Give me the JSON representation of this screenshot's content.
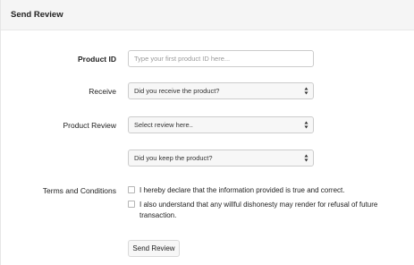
{
  "panel": {
    "title": "Send Review"
  },
  "form": {
    "product_id": {
      "label": "Product ID",
      "placeholder": "Type your first product ID here..."
    },
    "receive": {
      "label": "Receive",
      "selected": "Did you receive the product?"
    },
    "product_review": {
      "label": "Product Review",
      "selected": "Select review here.."
    },
    "keep": {
      "selected": "Did you keep the product?"
    },
    "terms": {
      "label": "Terms and Conditions",
      "checkbox_1": "I hereby declare that the information provided is true and correct.",
      "checkbox_2": "I also understand that any willful dishonesty may render for refusal of future transaction."
    },
    "submit_label": "Send Review"
  }
}
